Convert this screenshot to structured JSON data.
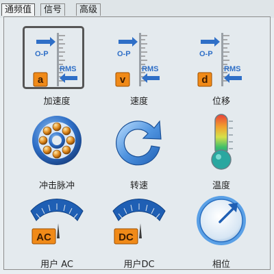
{
  "tabs": [
    {
      "label": "通频值"
    },
    {
      "label": "信号"
    },
    {
      "label": "高级"
    }
  ],
  "items": [
    {
      "label": "加速度",
      "icon": "acceleration-scale-icon",
      "letter": "a",
      "top_tag": "O-P",
      "bottom_tag": "RMS"
    },
    {
      "label": "速度",
      "icon": "velocity-scale-icon",
      "letter": "v",
      "top_tag": "O-P",
      "bottom_tag": "RMS"
    },
    {
      "label": "位移",
      "icon": "displacement-scale-icon",
      "letter": "d",
      "top_tag": "O-P",
      "bottom_tag": "RMS"
    },
    {
      "label": "冲击脉冲",
      "icon": "bearing-icon"
    },
    {
      "label": "转速",
      "icon": "rotation-icon"
    },
    {
      "label": "温度",
      "icon": "thermometer-icon"
    },
    {
      "label": "用户 AC",
      "icon": "ac-gauge-icon",
      "badge": "AC"
    },
    {
      "label": "用户DC",
      "icon": "dc-gauge-icon",
      "badge": "DC"
    },
    {
      "label": "相位",
      "icon": "phase-dial-icon"
    }
  ],
  "colors": {
    "badge_orange": "#f08a18",
    "arrow_blue": "#2f6fc7",
    "dial_blue": "#1f5fb4"
  }
}
